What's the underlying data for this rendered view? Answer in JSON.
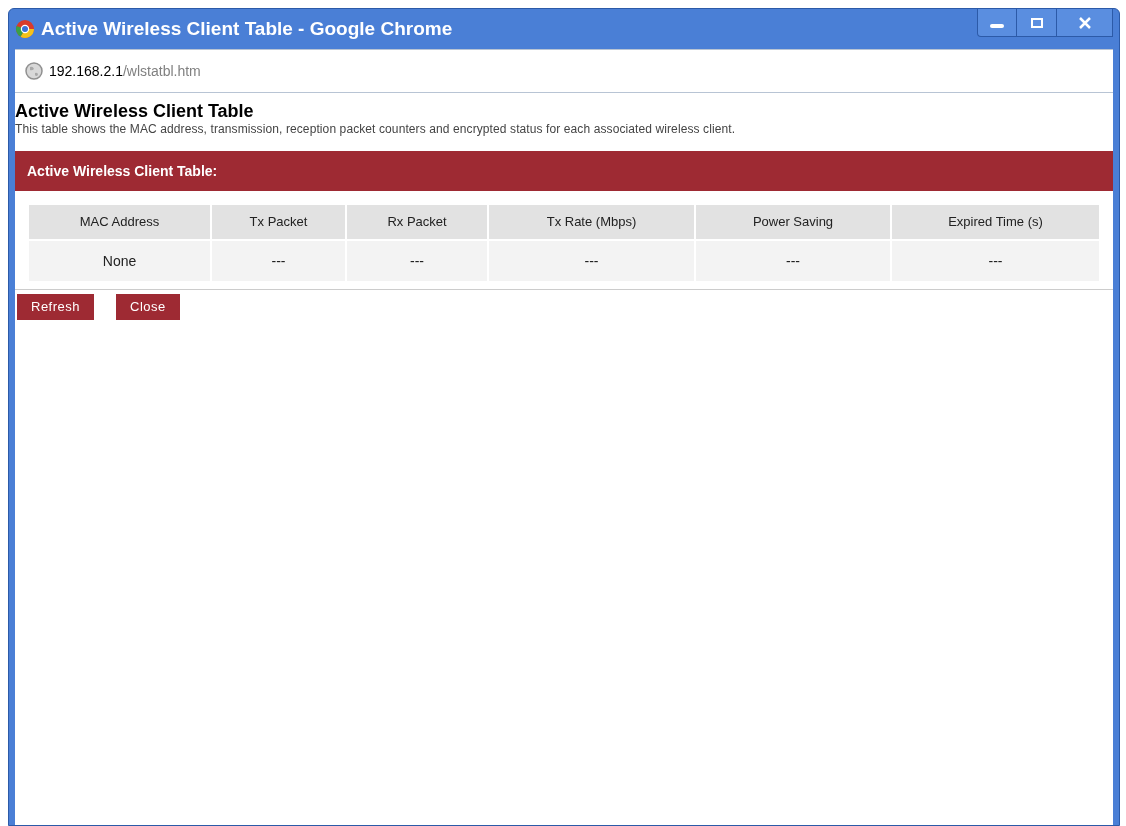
{
  "window": {
    "title": "Active Wireless Client Table - Google Chrome"
  },
  "address_bar": {
    "host": "192.168.2.1",
    "path": "/wlstatbl.htm"
  },
  "page": {
    "heading": "Active Wireless Client Table",
    "description": "This table shows the MAC address, transmission, reception packet counters and encrypted status for each associated wireless client."
  },
  "panel": {
    "title": "Active Wireless Client Table:",
    "columns": [
      "MAC Address",
      "Tx Packet",
      "Rx Packet",
      "Tx Rate (Mbps)",
      "Power Saving",
      "Expired Time (s)"
    ],
    "rows": [
      [
        "None",
        "---",
        "---",
        "---",
        "---",
        "---"
      ]
    ]
  },
  "buttons": [
    "Refresh",
    "Close"
  ]
}
